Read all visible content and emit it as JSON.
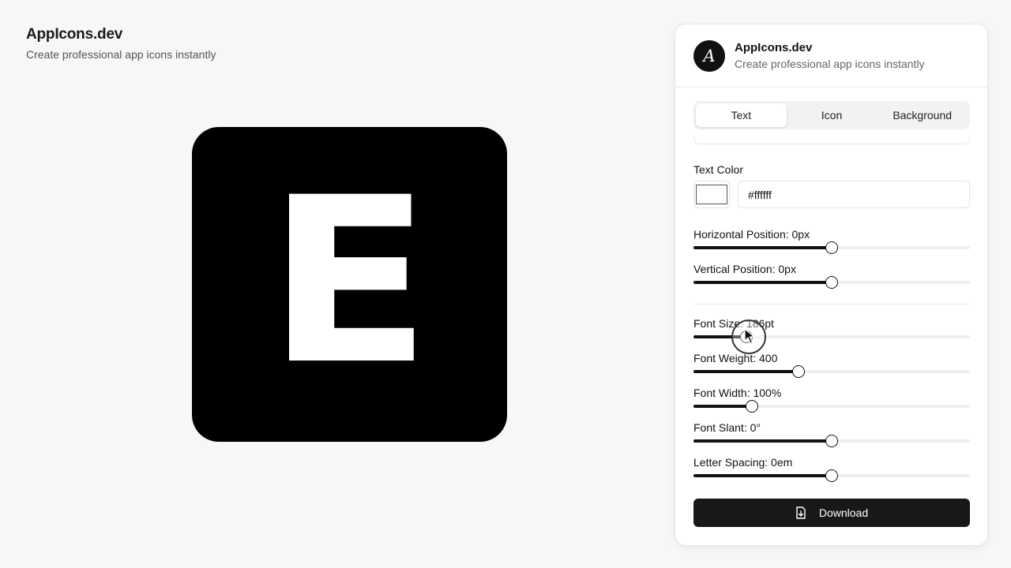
{
  "page": {
    "title": "AppIcons.dev",
    "subtitle": "Create professional app icons instantly"
  },
  "preview": {
    "letter": "E",
    "background_color": "#000000",
    "text_color": "#ffffff"
  },
  "panel": {
    "logo_glyph": "A",
    "title": "AppIcons.dev",
    "subtitle": "Create professional app icons instantly",
    "tabs": [
      {
        "label": "Text",
        "active": true
      },
      {
        "label": "Icon",
        "active": false
      },
      {
        "label": "Background",
        "active": false
      }
    ],
    "text_color": {
      "label": "Text Color",
      "value": "#ffffff"
    },
    "sliders": {
      "horizontal": {
        "label": "Horizontal Position: 0px",
        "level": 0.5
      },
      "vertical": {
        "label": "Vertical Position: 0px",
        "level": 0.5
      },
      "font_size": {
        "label": "Font Size: 186pt",
        "level": 0.19
      },
      "font_weight": {
        "label": "Font Weight: 400",
        "level": 0.38
      },
      "font_width": {
        "label": "Font Width: 100%",
        "level": 0.21
      },
      "font_slant": {
        "label": "Font Slant: 0°",
        "level": 0.5
      },
      "letter_spacing": {
        "label": "Letter Spacing: 0em",
        "level": 0.5
      }
    },
    "download_label": "Download"
  },
  "icons": {
    "logo": "serif-a-logo",
    "download": "file-download-icon",
    "cursor": "pointer-cursor-icon"
  }
}
